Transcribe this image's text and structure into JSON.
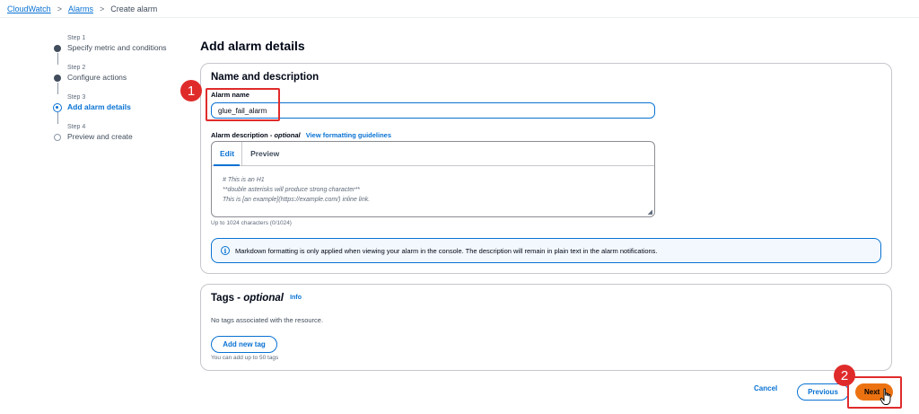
{
  "breadcrumb": {
    "root": "CloudWatch",
    "parent": "Alarms",
    "current": "Create alarm",
    "separator": ">"
  },
  "steps": [
    {
      "num": "Step 1",
      "title": "Specify metric and conditions",
      "state": "done"
    },
    {
      "num": "Step 2",
      "title": "Configure actions",
      "state": "done"
    },
    {
      "num": "Step 3",
      "title": "Add alarm details",
      "state": "active"
    },
    {
      "num": "Step 4",
      "title": "Preview and create",
      "state": "todo"
    }
  ],
  "page_title": "Add alarm details",
  "name_section": {
    "header": "Name and description",
    "name_label": "Alarm name",
    "name_value": "glue_fail_alarm",
    "desc_label": "Alarm description - ",
    "desc_optional": "optional",
    "format_link": "View formatting guidelines",
    "tab_edit": "Edit",
    "tab_preview": "Preview",
    "placeholder_lines": [
      "# This is an H1",
      "**double asterisks will produce strong character**",
      "This is [an example](https://example.com/) inline link."
    ],
    "char_count": "Up to 1024 characters (0/1024)",
    "info_icon": "i",
    "info_text": "Markdown formatting is only applied when viewing your alarm in the console. The description will remain in plain text in the alarm notifications."
  },
  "tags_section": {
    "header": "Tags - ",
    "header_optional": "optional",
    "info_link": "Info",
    "empty_text": "No tags associated with the resource.",
    "add_button": "Add new tag",
    "limit_text": "You can add up to 50 tags"
  },
  "footer": {
    "cancel": "Cancel",
    "previous": "Previous",
    "next": "Next"
  },
  "annotations": {
    "badge1": "1",
    "badge2": "2"
  },
  "colors": {
    "accent": "#0972d3",
    "primary_button": "#ec7211",
    "annotation": "#e02b2b"
  }
}
